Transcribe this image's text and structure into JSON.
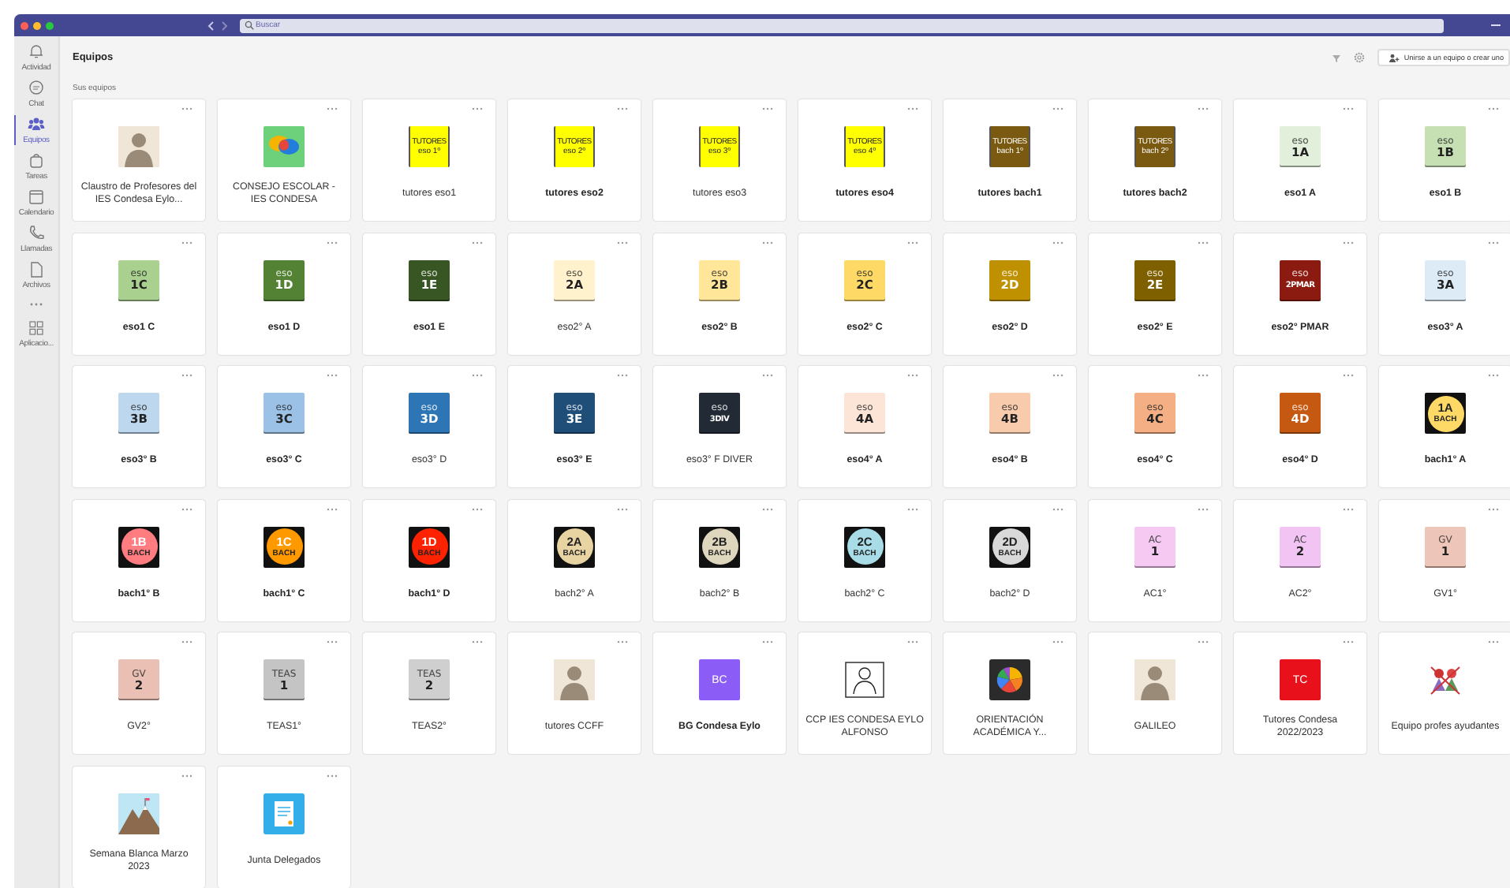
{
  "titlebar": {
    "search": {
      "placeholder": "Buscar"
    }
  },
  "rail": [
    {
      "label": "Actividad",
      "selected": false
    },
    {
      "label": "Chat",
      "selected": false
    },
    {
      "label": "Equipos",
      "selected": true
    },
    {
      "label": "Tareas",
      "selected": false
    },
    {
      "label": "Calendario",
      "selected": false
    },
    {
      "label": "Llamadas",
      "selected": false
    },
    {
      "label": "Archivos",
      "selected": false
    }
  ],
  "rail_apps": {
    "label": "Aplicacio..."
  },
  "header": {
    "title": "Equipos",
    "join_button": "Unirse a un equipo o crear uno"
  },
  "section_label": "Sus equipos",
  "teams": [
    {
      "name": "Claustro de Profesores del IES Condesa Eylo...",
      "unread": false,
      "avatar": {
        "kind": "portrait"
      }
    },
    {
      "name": "CONSEJO ESCOLAR - IES CONDESA",
      "unread": false,
      "avatar": {
        "kind": "chat"
      }
    },
    {
      "name": "tutores eso1",
      "unread": false,
      "avatar": {
        "kind": "tutores",
        "color": "#ffff00",
        "lines": [
          "TUTORES",
          "eso 1º"
        ]
      }
    },
    {
      "name": "tutores eso2",
      "unread": true,
      "avatar": {
        "kind": "tutores",
        "color": "#ffff00",
        "lines": [
          "TUTORES",
          "eso 2º"
        ]
      }
    },
    {
      "name": "tutores eso3",
      "unread": false,
      "avatar": {
        "kind": "tutores",
        "color": "#ffff00",
        "lines": [
          "TUTORES",
          "eso 3º"
        ]
      }
    },
    {
      "name": "tutores eso4",
      "unread": true,
      "avatar": {
        "kind": "tutores",
        "color": "#ffff00",
        "lines": [
          "TUTORES",
          "eso 4º"
        ]
      }
    },
    {
      "name": "tutores bach1",
      "unread": true,
      "avatar": {
        "kind": "tutores",
        "color": "#7a5a10",
        "lines": [
          "TUTORES",
          "bach 1º"
        ]
      }
    },
    {
      "name": "tutores bach2",
      "unread": true,
      "avatar": {
        "kind": "tutores",
        "color": "#7a5a10",
        "lines": [
          "TUTORES",
          "bach 2º"
        ]
      }
    },
    {
      "name": "eso1 A",
      "unread": true,
      "avatar": {
        "kind": "label",
        "color": "#e2efda",
        "lines": [
          "eso",
          "1A"
        ]
      }
    },
    {
      "name": "eso1 B",
      "unread": true,
      "avatar": {
        "kind": "label",
        "color": "#c6e0b4",
        "lines": [
          "eso",
          "1B"
        ]
      }
    },
    {
      "name": "eso1 C",
      "unread": true,
      "avatar": {
        "kind": "label",
        "color": "#a9d08e",
        "lines": [
          "eso",
          "1C"
        ]
      }
    },
    {
      "name": "eso1 D",
      "unread": true,
      "avatar": {
        "kind": "label",
        "color": "#548235",
        "lines": [
          "eso",
          "1D"
        ]
      }
    },
    {
      "name": "eso1 E",
      "unread": true,
      "avatar": {
        "kind": "label",
        "color": "#375623",
        "lines": [
          "eso",
          "1E"
        ]
      }
    },
    {
      "name": "eso2° A",
      "unread": false,
      "avatar": {
        "kind": "label",
        "color": "#fff2cc",
        "lines": [
          "eso",
          "2A"
        ]
      }
    },
    {
      "name": "eso2° B",
      "unread": true,
      "avatar": {
        "kind": "label",
        "color": "#ffe699",
        "lines": [
          "eso",
          "2B"
        ]
      }
    },
    {
      "name": "eso2° C",
      "unread": true,
      "avatar": {
        "kind": "label",
        "color": "#ffd966",
        "lines": [
          "eso",
          "2C"
        ]
      }
    },
    {
      "name": "eso2° D",
      "unread": true,
      "avatar": {
        "kind": "label",
        "color": "#bf9000",
        "lines": [
          "eso",
          "2D"
        ]
      }
    },
    {
      "name": "eso2° E",
      "unread": true,
      "avatar": {
        "kind": "label",
        "color": "#7f6000",
        "lines": [
          "eso",
          "2E"
        ]
      }
    },
    {
      "name": "eso2° PMAR",
      "unread": true,
      "avatar": {
        "kind": "label",
        "color": "#8b1a10",
        "lines": [
          "eso",
          "2PMAR"
        ]
      }
    },
    {
      "name": "eso3° A",
      "unread": true,
      "avatar": {
        "kind": "label",
        "color": "#ddebf7",
        "lines": [
          "eso",
          "3A"
        ]
      }
    },
    {
      "name": "eso3° B",
      "unread": true,
      "avatar": {
        "kind": "label",
        "color": "#bdd7ee",
        "lines": [
          "eso",
          "3B"
        ]
      }
    },
    {
      "name": "eso3° C",
      "unread": true,
      "avatar": {
        "kind": "label",
        "color": "#9bc2e6",
        "lines": [
          "eso",
          "3C"
        ]
      }
    },
    {
      "name": "eso3° D",
      "unread": false,
      "avatar": {
        "kind": "label",
        "color": "#2e75b6",
        "lines": [
          "eso",
          "3D"
        ]
      }
    },
    {
      "name": "eso3° E",
      "unread": true,
      "avatar": {
        "kind": "label",
        "color": "#1f4e79",
        "lines": [
          "eso",
          "3E"
        ]
      }
    },
    {
      "name": "eso3° F DIVER",
      "unread": false,
      "avatar": {
        "kind": "label",
        "color": "#222a35",
        "lines": [
          "eso",
          "3DIV"
        ]
      }
    },
    {
      "name": "eso4° A",
      "unread": true,
      "avatar": {
        "kind": "label",
        "color": "#fce4d6",
        "lines": [
          "eso",
          "4A"
        ]
      }
    },
    {
      "name": "eso4° B",
      "unread": true,
      "avatar": {
        "kind": "label",
        "color": "#f8cbad",
        "lines": [
          "eso",
          "4B"
        ]
      }
    },
    {
      "name": "eso4° C",
      "unread": true,
      "avatar": {
        "kind": "label",
        "color": "#f4b084",
        "lines": [
          "eso",
          "4C"
        ]
      }
    },
    {
      "name": "eso4° D",
      "unread": true,
      "avatar": {
        "kind": "label",
        "color": "#c65911",
        "lines": [
          "eso",
          "4D"
        ]
      }
    },
    {
      "name": "bach1° A",
      "unread": true,
      "avatar": {
        "kind": "bach",
        "color": "#ffd966",
        "lines": [
          "1A",
          "BACH"
        ]
      }
    },
    {
      "name": "bach1° B",
      "unread": true,
      "avatar": {
        "kind": "bach",
        "color": "#ff7c80",
        "lines": [
          "1B",
          "BACH"
        ]
      }
    },
    {
      "name": "bach1° C",
      "unread": true,
      "avatar": {
        "kind": "bach",
        "color": "#ff9900",
        "lines": [
          "1C",
          "BACH"
        ]
      }
    },
    {
      "name": "bach1° D",
      "unread": true,
      "avatar": {
        "kind": "bach",
        "color": "#ff2200",
        "lines": [
          "1D",
          "BACH"
        ]
      }
    },
    {
      "name": "bach2° A",
      "unread": false,
      "avatar": {
        "kind": "bach",
        "color": "#e8d4a2",
        "lines": [
          "2A",
          "BACH"
        ]
      }
    },
    {
      "name": "bach2° B",
      "unread": false,
      "avatar": {
        "kind": "bach",
        "color": "#ded6bd",
        "lines": [
          "2B",
          "BACH"
        ]
      }
    },
    {
      "name": "bach2° C",
      "unread": false,
      "avatar": {
        "kind": "bach",
        "color": "#a8dde8",
        "lines": [
          "2C",
          "BACH"
        ]
      }
    },
    {
      "name": "bach2° D",
      "unread": false,
      "avatar": {
        "kind": "bach",
        "color": "#d9d9d9",
        "lines": [
          "2D",
          "BACH"
        ]
      }
    },
    {
      "name": "AC1°",
      "unread": false,
      "avatar": {
        "kind": "label",
        "color": "#f5c9f2",
        "lines": [
          "AC",
          "1"
        ]
      }
    },
    {
      "name": "AC2°",
      "unread": false,
      "avatar": {
        "kind": "label",
        "color": "#f2c4f4",
        "lines": [
          "AC",
          "2"
        ]
      }
    },
    {
      "name": "GV1°",
      "unread": false,
      "avatar": {
        "kind": "label",
        "color": "#eec5b9",
        "lines": [
          "GV",
          "1"
        ]
      }
    },
    {
      "name": "GV2°",
      "unread": false,
      "avatar": {
        "kind": "label",
        "color": "#ebc0b4",
        "lines": [
          "GV",
          "2"
        ]
      }
    },
    {
      "name": "TEAS1°",
      "unread": false,
      "avatar": {
        "kind": "label",
        "color": "#c4c4c4",
        "lines": [
          "TEAS",
          "1"
        ]
      }
    },
    {
      "name": "TEAS2°",
      "unread": false,
      "avatar": {
        "kind": "label",
        "color": "#cfcfcf",
        "lines": [
          "TEAS",
          "2"
        ]
      }
    },
    {
      "name": "tutores CCFF",
      "unread": false,
      "avatar": {
        "kind": "portrait"
      }
    },
    {
      "name": "BG Condesa Eylo",
      "unread": true,
      "avatar": {
        "kind": "initials",
        "color": "#8b5cf6",
        "lines": [
          "BC"
        ]
      }
    },
    {
      "name": "CCP IES CONDESA EYLO ALFONSO",
      "unread": false,
      "avatar": {
        "kind": "sketch"
      }
    },
    {
      "name": "ORIENTACIÓN ACADÉMICA Y...",
      "unread": false,
      "avatar": {
        "kind": "colorwheel"
      }
    },
    {
      "name": "GALILEO",
      "unread": false,
      "avatar": {
        "kind": "portrait"
      }
    },
    {
      "name": "Tutores Condesa 2022/2023",
      "unread": false,
      "avatar": {
        "kind": "initials",
        "color": "#e8101a",
        "lines": [
          "TC"
        ]
      }
    },
    {
      "name": "Equipo profes ayudantes",
      "unread": false,
      "avatar": {
        "kind": "figures"
      }
    },
    {
      "name": "Semana Blanca Marzo 2023",
      "unread": false,
      "avatar": {
        "kind": "mountain"
      }
    },
    {
      "name": "Junta Delegados",
      "unread": false,
      "avatar": {
        "kind": "document"
      }
    }
  ]
}
